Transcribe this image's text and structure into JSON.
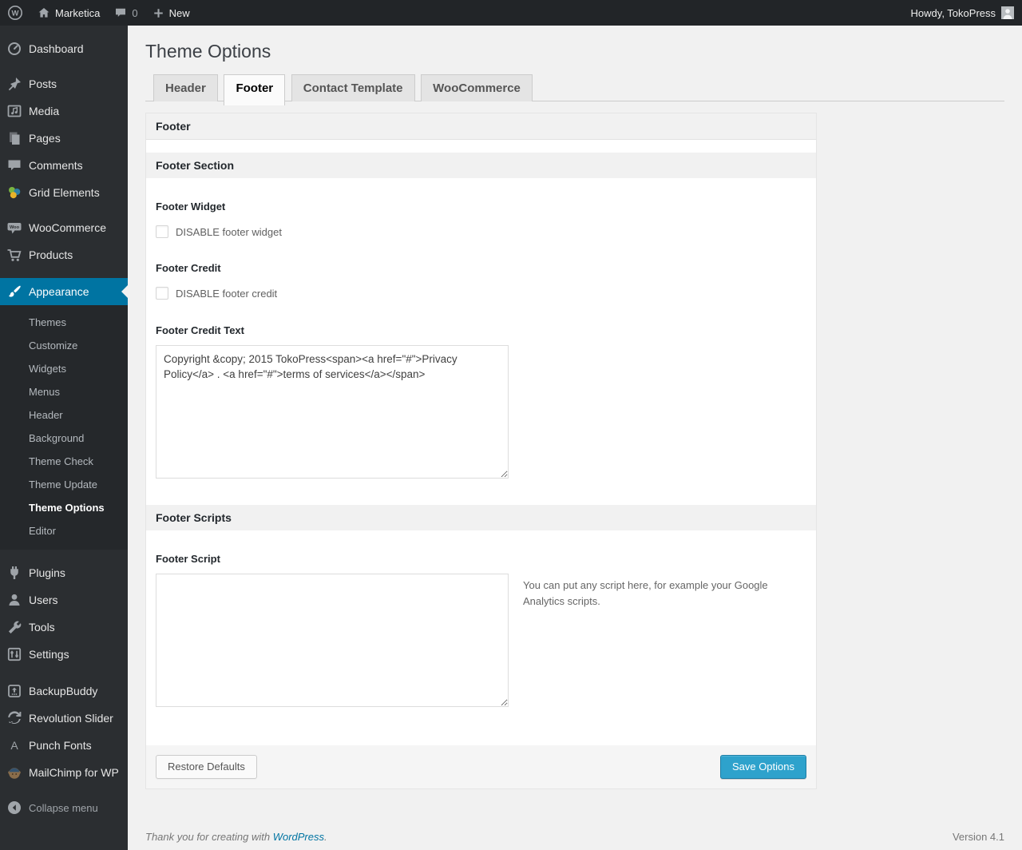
{
  "colors": {
    "accent_blue": "#0074a2",
    "primary_button_blue": "#2ea2cc",
    "admin_bar_bg": "#222528",
    "menu_bg": "#2b2e31",
    "submenu_bg": "#25282b",
    "content_bg": "#f1f1f1"
  },
  "admin_bar": {
    "site_name": "Marketica",
    "comment_count": "0",
    "new_label": "New",
    "howdy": "Howdy, TokoPress"
  },
  "sidebar": {
    "menu": [
      {
        "label": "Dashboard"
      },
      {
        "label": "Posts"
      },
      {
        "label": "Media"
      },
      {
        "label": "Pages"
      },
      {
        "label": "Comments"
      },
      {
        "label": "Grid Elements"
      },
      {
        "label": "WooCommerce"
      },
      {
        "label": "Products"
      },
      {
        "label": "Appearance"
      },
      {
        "label": "Plugins"
      },
      {
        "label": "Users"
      },
      {
        "label": "Tools"
      },
      {
        "label": "Settings"
      },
      {
        "label": "BackupBuddy"
      },
      {
        "label": "Revolution Slider"
      },
      {
        "label": "Punch Fonts"
      },
      {
        "label": "MailChimp for WP"
      }
    ],
    "appearance_submenu": [
      "Themes",
      "Customize",
      "Widgets",
      "Menus",
      "Header",
      "Background",
      "Theme Check",
      "Theme Update",
      "Theme Options",
      "Editor"
    ],
    "active_item": "Appearance",
    "active_submenu_item": "Theme Options",
    "collapse_label": "Collapse menu"
  },
  "page": {
    "title": "Theme Options",
    "tabs": [
      {
        "label": "Header",
        "active": false
      },
      {
        "label": "Footer",
        "active": true
      },
      {
        "label": "Contact Template",
        "active": false
      },
      {
        "label": "WooCommerce",
        "active": false
      }
    ]
  },
  "panel": {
    "box_title": "Footer",
    "section1": {
      "title": "Footer Section",
      "footer_widget_label": "Footer Widget",
      "footer_widget_checkbox": "DISABLE footer widget",
      "footer_widget_checked": false,
      "footer_credit_label": "Footer Credit",
      "footer_credit_checkbox": "DISABLE footer credit",
      "footer_credit_checked": false,
      "footer_credit_text_label": "Footer Credit Text",
      "footer_credit_text_value": "Copyright &copy; 2015 TokoPress<span><a href=\"#\">Privacy Policy</a> . <a href=\"#\">terms of services</a></span>"
    },
    "section2": {
      "title": "Footer Scripts",
      "footer_script_label": "Footer Script",
      "footer_script_value": "",
      "footer_script_help": "You can put any script here, for example your Google Analytics scripts."
    },
    "restore_button": "Restore Defaults",
    "save_button": "Save Options"
  },
  "footer": {
    "thanks_prefix": "Thank you for creating with ",
    "thanks_link": "WordPress",
    "thanks_suffix": ".",
    "version": "Version 4.1"
  }
}
